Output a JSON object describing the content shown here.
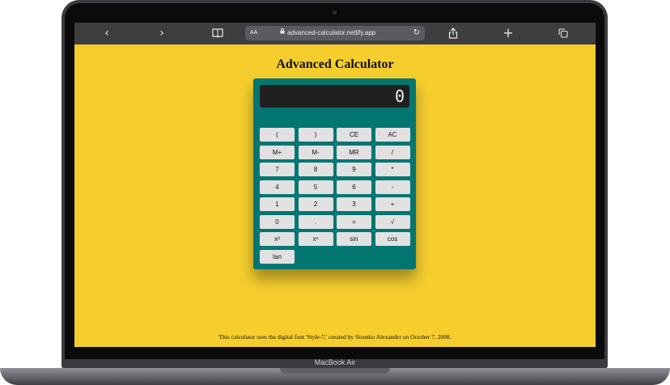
{
  "browser": {
    "reader_label": "AA",
    "url": "advanced-calculator.netlify.app"
  },
  "page": {
    "title": "Advanced Calculator",
    "footer": "This calculator uses the digital font 'Style-7,' created by Sizenko Alexander on October 7, 2008."
  },
  "calculator": {
    "display": "0",
    "keys": [
      "(",
      ")",
      "CE",
      "AC",
      "M+",
      "M-",
      "MR",
      "/",
      "7",
      "8",
      "9",
      "*",
      "4",
      "5",
      "6",
      "-",
      "1",
      "2",
      "3",
      "+",
      "0",
      ".",
      "=",
      "√",
      "x²",
      "xⁿ",
      "sin",
      "cos",
      "tan"
    ]
  },
  "device": {
    "label": "MacBook Air"
  },
  "colors": {
    "page_bg": "#f5ce2e",
    "calculator_body": "#047672",
    "display_bg": "#202020",
    "key_bg": "#e1e1e1"
  }
}
